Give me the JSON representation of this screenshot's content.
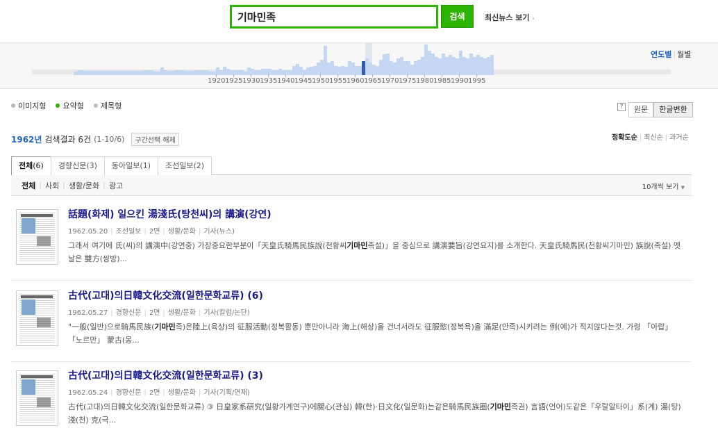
{
  "search": {
    "value": "기마민족",
    "button_label": "검색",
    "latest_news_label": "최신뉴스 보기",
    "latest_news_arrow": "›"
  },
  "histogram": {
    "view_year_label": "연도별",
    "view_month_label": "월별",
    "selected_year": 1962,
    "years": [
      1920,
      1925,
      1930,
      1935,
      1940,
      1945,
      1950,
      1955,
      1960,
      1965,
      1970,
      1975,
      1980,
      1985,
      1990,
      1995
    ],
    "counts": [
      0.12,
      0.17,
      0.17,
      0.14,
      0.14,
      0.14,
      0.14,
      0.14,
      0.14,
      0.14,
      0.14,
      0.14,
      0.14,
      0.14,
      0.14,
      0.14,
      0.14,
      0.14,
      0.14,
      0.14,
      0.17,
      0.17,
      0.17,
      0.12,
      0.12,
      0.24,
      0.17,
      0.14,
      0.14,
      0.17,
      0.17,
      0.17,
      0.14,
      0.14,
      0.14,
      0.17,
      0.17,
      0.17,
      0.17,
      0.12,
      0.12,
      0.24,
      0.17,
      0.27,
      0.2,
      0.17,
      0.17,
      0.17,
      0.17,
      0.12,
      0.24,
      0.2,
      0.17,
      0.17,
      0.2,
      0.2,
      0.2,
      0.17,
      0.17,
      0.2,
      0.17,
      0.17,
      0.17,
      0.3,
      0.37,
      0.27,
      0.17,
      0.24,
      0.27,
      0.3,
      0.4,
      0.5,
      0.96,
      0.4,
      0.45,
      0.3,
      0.27,
      0.3,
      0.27,
      0.45,
      0.4,
      0.3,
      0.3,
      0.45,
      0.55,
      0.4,
      0.35,
      0.3,
      0.5,
      0.68,
      0.7,
      0.45,
      0.4,
      0.55,
      0.6,
      0.45,
      0.45,
      0.35,
      0.45,
      0.5,
      0.6,
      1.0,
      0.8,
      0.7,
      0.6,
      0.55,
      0.7,
      0.6,
      0.65,
      0.6,
      0.55,
      0.8,
      0.6,
      0.55,
      0.7,
      0.6,
      0.65,
      0.6,
      0.55,
      0.6,
      0.65
    ]
  },
  "modes": [
    {
      "label": "이미지형",
      "active": false
    },
    {
      "label": "요약형",
      "active": true
    },
    {
      "label": "제목형",
      "active": false
    }
  ],
  "help_label": "?",
  "lang_tabs": [
    {
      "label": "원문",
      "active": false
    },
    {
      "label": "한글변환",
      "active": true
    }
  ],
  "summary": {
    "year": "1962년",
    "result_text": "검색결과 6건",
    "range_text": "(1-10/6)",
    "clear_label": "구간선택 해제"
  },
  "sort": [
    {
      "label": "정확도순",
      "active": true
    },
    {
      "label": "최신순",
      "active": false
    },
    {
      "label": "과거순",
      "active": false
    }
  ],
  "source_tabs": [
    {
      "label": "전체",
      "count": "(6)",
      "active": true
    },
    {
      "label": "경향신문",
      "count": "(3)",
      "active": false
    },
    {
      "label": "동아일보",
      "count": "(1)",
      "active": false
    },
    {
      "label": "조선일보",
      "count": "(2)",
      "active": false
    }
  ],
  "subcats": [
    {
      "label": "전체",
      "active": true
    },
    {
      "label": "사회",
      "active": false
    },
    {
      "label": "생활/문화",
      "active": false
    },
    {
      "label": "광고",
      "active": false
    }
  ],
  "per_page": {
    "label": "10개씩 보기",
    "caret": "▼"
  },
  "results": [
    {
      "title": "話題(화제) 일으킨 湯淺氏(탕천씨)의 講演(강연)",
      "date": "1962.05.20",
      "paper": "조선일보",
      "page": "2면",
      "section": "생활/문화",
      "type": "기사(뉴스)",
      "snippet_before": "그래서 여기에 氏(씨)의 講演中(강연중) 가장중요한부분이「天皇氏騎馬民族說(천황씨",
      "snippet_highlight": "기마민",
      "snippet_after": "족설)」을 중심으로 講演要旨(강연요지)를 소개한다. 天皇氏騎馬民(천황씨기마민) 族說(족설) 옛날은 雙方(쌍방)..."
    },
    {
      "title": "古代(고대)의日韓文化交流(일한문화교류) (6)",
      "date": "1962.05.27",
      "paper": "경향신문",
      "page": "2면",
      "section": "생활/문화",
      "type": "기사(칼럼/논단)",
      "snippet_before": "\"一般(일반)으로騎馬民族(",
      "snippet_highlight": "기마민",
      "snippet_after": "족)은陸上(육상)의 征服活動(정복활동) 뿐만아니라 海上(해상)을 건너서라도 征服慾(정복욕)을 滿足(만족)시키려는 例(예)가 적지않다는것. 가령 「아랍」 「노르만」 蒙古(몽..."
    },
    {
      "title": "古代(고대)의日韓文化交流(일한문화교류) (3)",
      "date": "1962.05.24",
      "paper": "경향신문",
      "page": "2면",
      "section": "생활/문화",
      "type": "기사(기획/연재)",
      "snippet_before": "古代(고대)의日韓文化交流(일한문화교류) ③ 日皇家系硏究(일황가계연구)에關心(관심) 韓(한)·日文化(일문화)는같은騎馬民族圈(",
      "snippet_highlight": "기마민",
      "snippet_after": "족권) 言語(언어)도같은「우랄알타이」系(계) 湯(탕) 淺(천) 克(극..."
    }
  ],
  "colors": {
    "accent_green": "#2db400",
    "link_blue": "#2265c2",
    "title_navy": "#1a1a8c",
    "bar_blue": "#c4d6f2",
    "bar_selected": "#2f5fae"
  }
}
